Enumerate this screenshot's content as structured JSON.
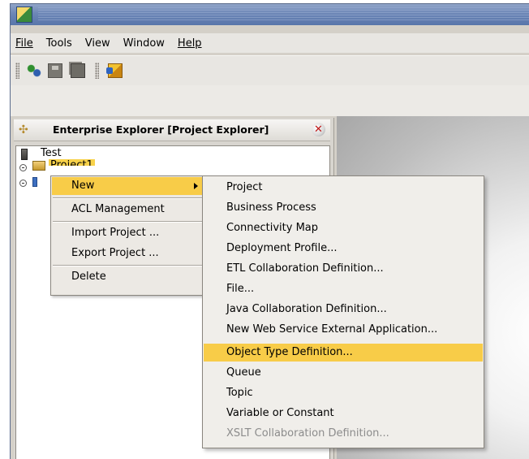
{
  "menubar": {
    "items": [
      "File",
      "Tools",
      "View",
      "Window",
      "Help"
    ]
  },
  "toolbar": {
    "buttons": [
      "refresh-icon",
      "save-icon",
      "save-all-icon",
      "import-icon"
    ]
  },
  "explorer": {
    "title": "Enterprise Explorer [Project Explorer]",
    "tree": {
      "root": "Test",
      "project": "Project1"
    }
  },
  "context_menu": {
    "items": [
      "New",
      "ACL Management",
      "Import Project ...",
      "Export Project ...",
      "Delete"
    ],
    "selected": "New"
  },
  "submenu": {
    "items": [
      "Project",
      "Business Process",
      "Connectivity Map",
      "Deployment Profile...",
      "ETL Collaboration Definition...",
      "File...",
      "Java Collaboration Definition...",
      "New Web Service External Application...",
      "Object Type Definition...",
      "Queue",
      "Topic",
      "Variable or Constant",
      "XSLT Collaboration Definition..."
    ],
    "selected": "Object Type Definition...",
    "disabled": "XSLT Collaboration Definition..."
  },
  "colors": {
    "highlight": "#f8cc48",
    "titlebar": "#6c86b6",
    "disabled_text": "#8c8c8c"
  }
}
